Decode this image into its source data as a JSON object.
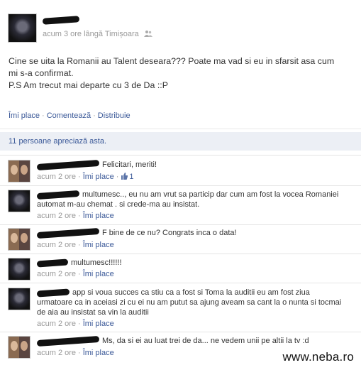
{
  "post": {
    "author": "",
    "time": "acum 3 ore lângă Timișoara",
    "text_lines": [
      "Cine se uita la Romanii au Talent deseara??? Poate ma vad si eu in sfarsit asa cum",
      "mi s-a confirmat.",
      "P.S Am trecut mai departe cu 3 de Da ::P"
    ],
    "actions": {
      "like": "Îmi place",
      "comment": "Comentează",
      "share": "Distribuie",
      "sep": "·"
    },
    "likes_summary": "11 persoane apreciază asta.",
    "audience_icon": "friends-icon"
  },
  "comments": [
    {
      "text_lines": [
        "Felicitari, meriti!"
      ],
      "time": "acum 2 ore",
      "like": "Îmi place",
      "like_count": "1",
      "avatar": "duo"
    },
    {
      "text_lines": [
        "multumesc.., eu nu am vrut sa particip dar cum am fost la vocea Romaniei",
        "automat m-au chemat . si crede-ma au insistat."
      ],
      "time": "acum 2 ore",
      "like": "Îmi place",
      "avatar": "dark"
    },
    {
      "text_lines": [
        "F bine de ce nu? Congrats inca o data!"
      ],
      "time": "acum 2 ore",
      "like": "Îmi place",
      "avatar": "duo"
    },
    {
      "text_lines": [
        "multumesc!!!!!!"
      ],
      "time": "acum 2 ore",
      "like": "Îmi place",
      "avatar": "dark"
    },
    {
      "text_lines": [
        "app si voua succes ca stiu ca a fost si Toma la auditii eu am fost ziua",
        "urmatoare ca in aceiasi zi cu ei nu am putut sa ajung aveam sa cant la o nunta si tocmai",
        "de aia au insistat sa vin la auditii"
      ],
      "time": "acum 2 ore",
      "like": "Îmi place",
      "avatar": "dark"
    },
    {
      "text_lines": [
        "Ms, da si ei au luat trei de da... ne vedem unii pe altii la tv :d"
      ],
      "time": "acum 2 ore",
      "like": "Îmi place",
      "avatar": "duo"
    }
  ],
  "watermark": "www.neba.ro"
}
